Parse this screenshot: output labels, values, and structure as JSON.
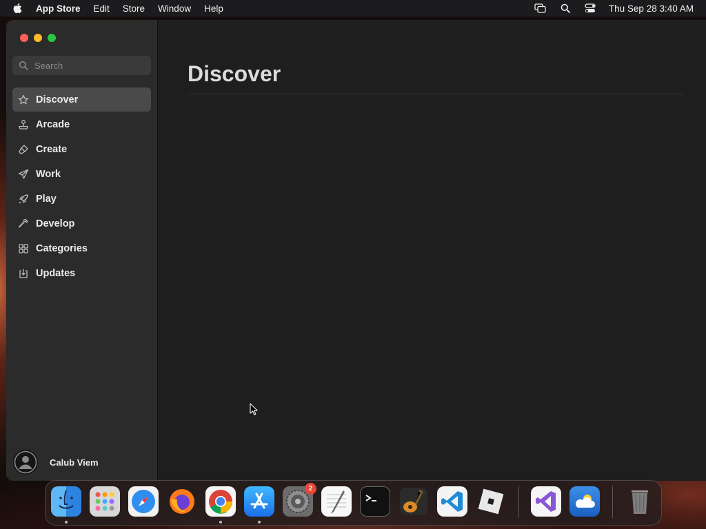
{
  "menubar": {
    "apple_icon": "apple-logo-icon",
    "app_name": "App Store",
    "items": [
      "Edit",
      "Store",
      "Window",
      "Help"
    ],
    "status_icons": [
      "screen-mirroring-icon",
      "spotlight-search-icon",
      "control-center-icon"
    ],
    "clock": "Thu Sep 28  3:40 AM"
  },
  "sidebar": {
    "search": {
      "placeholder": "Search"
    },
    "items": [
      {
        "label": "Discover",
        "icon": "star-icon",
        "active": true
      },
      {
        "label": "Arcade",
        "icon": "joystick-icon",
        "active": false
      },
      {
        "label": "Create",
        "icon": "brush-icon",
        "active": false
      },
      {
        "label": "Work",
        "icon": "paper-plane-icon",
        "active": false
      },
      {
        "label": "Play",
        "icon": "rocket-icon",
        "active": false
      },
      {
        "label": "Develop",
        "icon": "hammer-icon",
        "active": false
      },
      {
        "label": "Categories",
        "icon": "grid-icon",
        "active": false
      },
      {
        "label": "Updates",
        "icon": "download-icon",
        "active": false
      }
    ],
    "user": {
      "name": "Calub Viem"
    }
  },
  "main": {
    "title": "Discover"
  },
  "dock": {
    "apps": [
      {
        "name": "Finder",
        "icon": "finder-icon",
        "running": true
      },
      {
        "name": "Launchpad",
        "icon": "launchpad-icon",
        "running": false
      },
      {
        "name": "Safari",
        "icon": "safari-icon",
        "running": false
      },
      {
        "name": "Firefox",
        "icon": "firefox-icon",
        "running": false
      },
      {
        "name": "Chrome",
        "icon": "chrome-icon",
        "running": true
      },
      {
        "name": "App Store",
        "icon": "app-store-icon",
        "running": true
      },
      {
        "name": "System Settings",
        "icon": "system-settings-icon",
        "running": false,
        "badge": "2"
      },
      {
        "name": "TextEdit",
        "icon": "textedit-icon",
        "running": false
      },
      {
        "name": "Terminal",
        "icon": "terminal-icon",
        "running": false
      },
      {
        "name": "GarageBand",
        "icon": "garageband-icon",
        "running": false
      },
      {
        "name": "VS Code",
        "icon": "vscode-icon",
        "running": false
      },
      {
        "name": "Roblox",
        "icon": "roblox-icon",
        "running": false
      },
      {
        "name": "Visual Studio",
        "icon": "visual-studio-icon",
        "running": false
      },
      {
        "name": "Weather",
        "icon": "weather-icon",
        "running": false
      },
      {
        "name": "Trash",
        "icon": "trash-icon",
        "running": false
      }
    ]
  },
  "colors": {
    "sidebar_bg": "#2b2b2b",
    "main_bg": "#1e1e1e",
    "active_item_bg": "#4a4a4a",
    "badge": "#e5453a"
  }
}
